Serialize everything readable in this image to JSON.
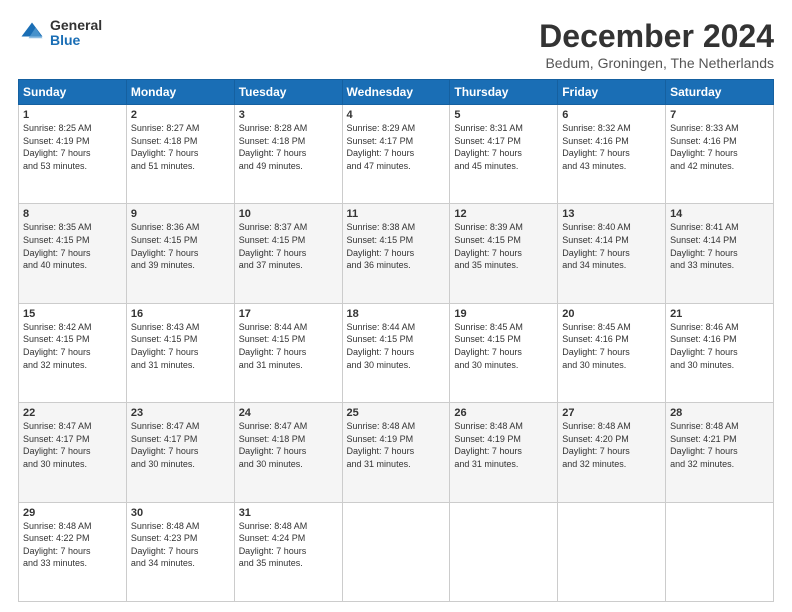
{
  "logo": {
    "general": "General",
    "blue": "Blue"
  },
  "title": {
    "month_year": "December 2024",
    "location": "Bedum, Groningen, The Netherlands"
  },
  "weekdays": [
    "Sunday",
    "Monday",
    "Tuesday",
    "Wednesday",
    "Thursday",
    "Friday",
    "Saturday"
  ],
  "weeks": [
    [
      {
        "day": "1",
        "info": "Sunrise: 8:25 AM\nSunset: 4:19 PM\nDaylight: 7 hours\nand 53 minutes."
      },
      {
        "day": "2",
        "info": "Sunrise: 8:27 AM\nSunset: 4:18 PM\nDaylight: 7 hours\nand 51 minutes."
      },
      {
        "day": "3",
        "info": "Sunrise: 8:28 AM\nSunset: 4:18 PM\nDaylight: 7 hours\nand 49 minutes."
      },
      {
        "day": "4",
        "info": "Sunrise: 8:29 AM\nSunset: 4:17 PM\nDaylight: 7 hours\nand 47 minutes."
      },
      {
        "day": "5",
        "info": "Sunrise: 8:31 AM\nSunset: 4:17 PM\nDaylight: 7 hours\nand 45 minutes."
      },
      {
        "day": "6",
        "info": "Sunrise: 8:32 AM\nSunset: 4:16 PM\nDaylight: 7 hours\nand 43 minutes."
      },
      {
        "day": "7",
        "info": "Sunrise: 8:33 AM\nSunset: 4:16 PM\nDaylight: 7 hours\nand 42 minutes."
      }
    ],
    [
      {
        "day": "8",
        "info": "Sunrise: 8:35 AM\nSunset: 4:15 PM\nDaylight: 7 hours\nand 40 minutes."
      },
      {
        "day": "9",
        "info": "Sunrise: 8:36 AM\nSunset: 4:15 PM\nDaylight: 7 hours\nand 39 minutes."
      },
      {
        "day": "10",
        "info": "Sunrise: 8:37 AM\nSunset: 4:15 PM\nDaylight: 7 hours\nand 37 minutes."
      },
      {
        "day": "11",
        "info": "Sunrise: 8:38 AM\nSunset: 4:15 PM\nDaylight: 7 hours\nand 36 minutes."
      },
      {
        "day": "12",
        "info": "Sunrise: 8:39 AM\nSunset: 4:15 PM\nDaylight: 7 hours\nand 35 minutes."
      },
      {
        "day": "13",
        "info": "Sunrise: 8:40 AM\nSunset: 4:14 PM\nDaylight: 7 hours\nand 34 minutes."
      },
      {
        "day": "14",
        "info": "Sunrise: 8:41 AM\nSunset: 4:14 PM\nDaylight: 7 hours\nand 33 minutes."
      }
    ],
    [
      {
        "day": "15",
        "info": "Sunrise: 8:42 AM\nSunset: 4:15 PM\nDaylight: 7 hours\nand 32 minutes."
      },
      {
        "day": "16",
        "info": "Sunrise: 8:43 AM\nSunset: 4:15 PM\nDaylight: 7 hours\nand 31 minutes."
      },
      {
        "day": "17",
        "info": "Sunrise: 8:44 AM\nSunset: 4:15 PM\nDaylight: 7 hours\nand 31 minutes."
      },
      {
        "day": "18",
        "info": "Sunrise: 8:44 AM\nSunset: 4:15 PM\nDaylight: 7 hours\nand 30 minutes."
      },
      {
        "day": "19",
        "info": "Sunrise: 8:45 AM\nSunset: 4:15 PM\nDaylight: 7 hours\nand 30 minutes."
      },
      {
        "day": "20",
        "info": "Sunrise: 8:45 AM\nSunset: 4:16 PM\nDaylight: 7 hours\nand 30 minutes."
      },
      {
        "day": "21",
        "info": "Sunrise: 8:46 AM\nSunset: 4:16 PM\nDaylight: 7 hours\nand 30 minutes."
      }
    ],
    [
      {
        "day": "22",
        "info": "Sunrise: 8:47 AM\nSunset: 4:17 PM\nDaylight: 7 hours\nand 30 minutes."
      },
      {
        "day": "23",
        "info": "Sunrise: 8:47 AM\nSunset: 4:17 PM\nDaylight: 7 hours\nand 30 minutes."
      },
      {
        "day": "24",
        "info": "Sunrise: 8:47 AM\nSunset: 4:18 PM\nDaylight: 7 hours\nand 30 minutes."
      },
      {
        "day": "25",
        "info": "Sunrise: 8:48 AM\nSunset: 4:19 PM\nDaylight: 7 hours\nand 31 minutes."
      },
      {
        "day": "26",
        "info": "Sunrise: 8:48 AM\nSunset: 4:19 PM\nDaylight: 7 hours\nand 31 minutes."
      },
      {
        "day": "27",
        "info": "Sunrise: 8:48 AM\nSunset: 4:20 PM\nDaylight: 7 hours\nand 32 minutes."
      },
      {
        "day": "28",
        "info": "Sunrise: 8:48 AM\nSunset: 4:21 PM\nDaylight: 7 hours\nand 32 minutes."
      }
    ],
    [
      {
        "day": "29",
        "info": "Sunrise: 8:48 AM\nSunset: 4:22 PM\nDaylight: 7 hours\nand 33 minutes."
      },
      {
        "day": "30",
        "info": "Sunrise: 8:48 AM\nSunset: 4:23 PM\nDaylight: 7 hours\nand 34 minutes."
      },
      {
        "day": "31",
        "info": "Sunrise: 8:48 AM\nSunset: 4:24 PM\nDaylight: 7 hours\nand 35 minutes."
      },
      null,
      null,
      null,
      null
    ]
  ]
}
